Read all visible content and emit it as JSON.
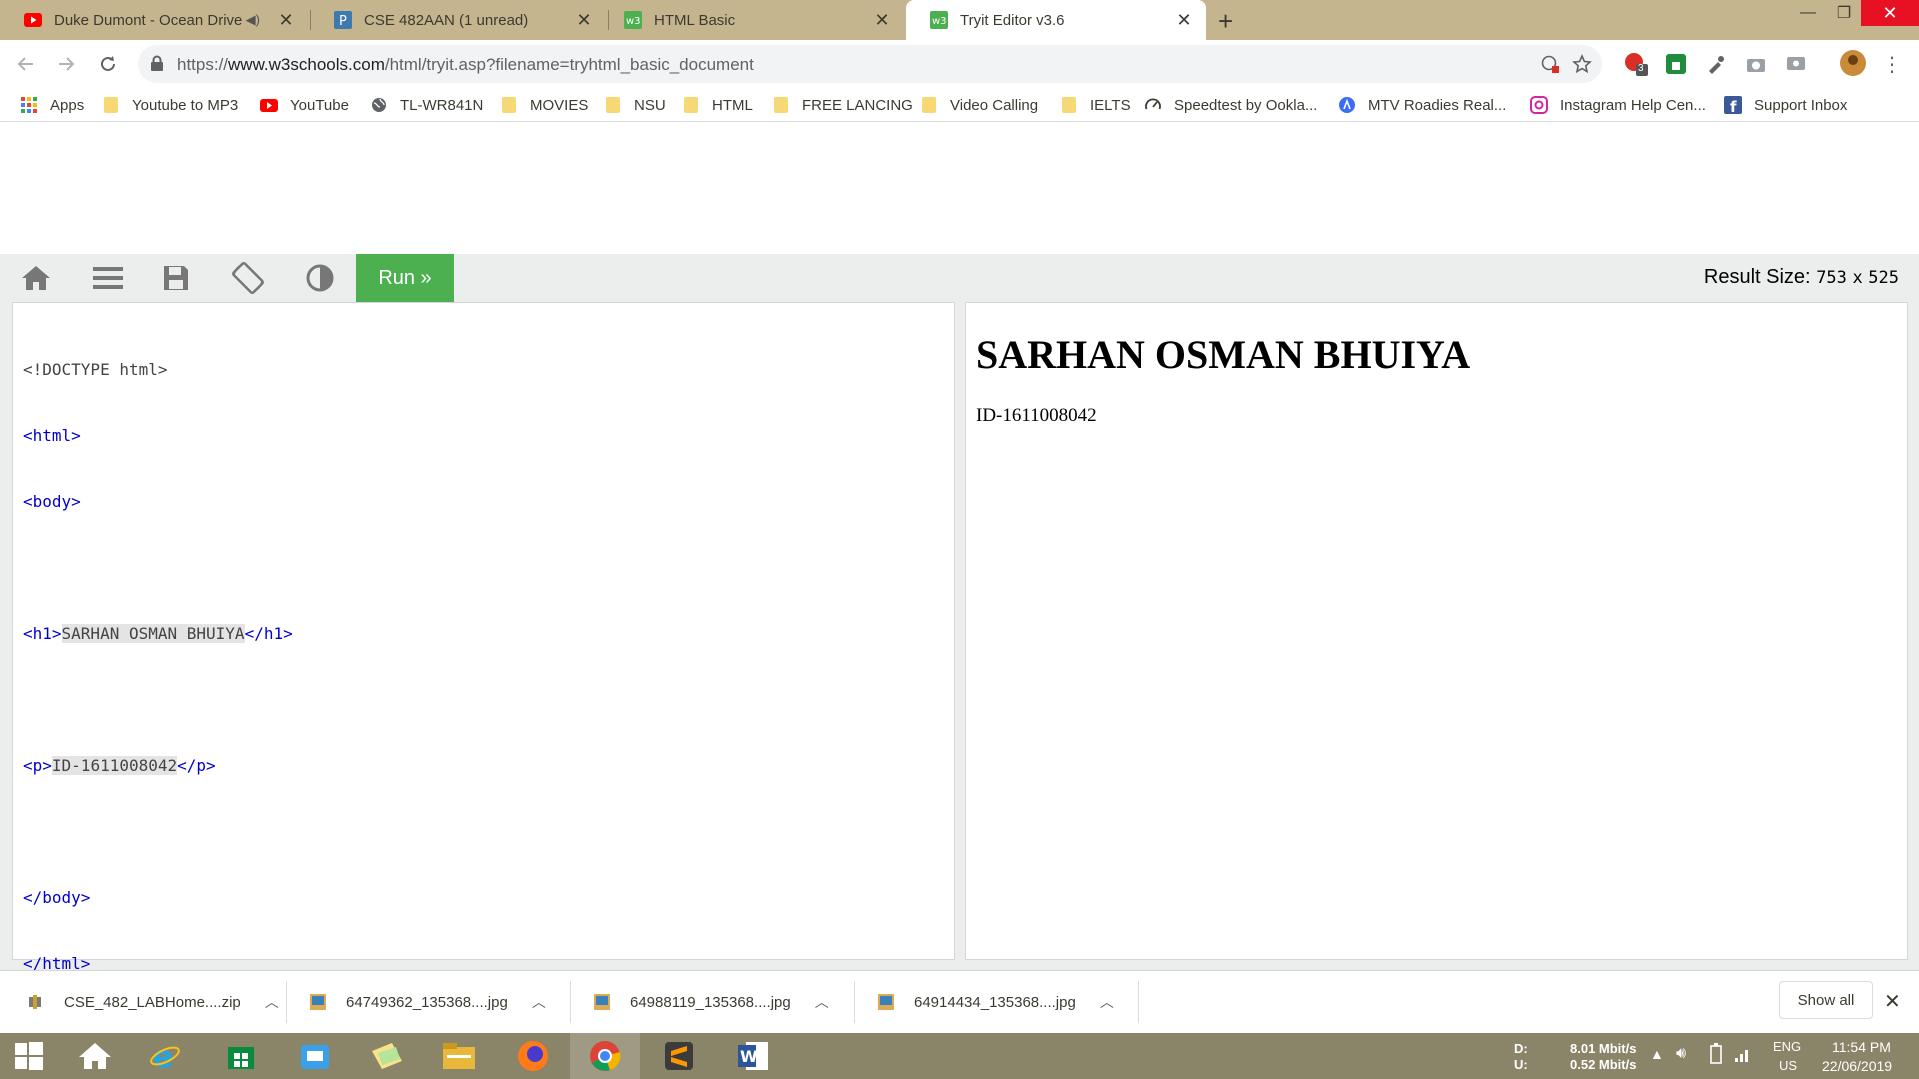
{
  "browser": {
    "tabs": [
      {
        "title": "Duke Dumont - Ocean Drive",
        "favicon": "youtube-icon",
        "muted_indicator": "speaker-icon"
      },
      {
        "title": "CSE 482AAN (1 unread)",
        "favicon": "piazza-icon"
      },
      {
        "title": "HTML Basic",
        "favicon": "w3schools-icon"
      },
      {
        "title": "Tryit Editor v3.6",
        "favicon": "w3schools-icon",
        "active": true
      }
    ],
    "url_prefix": "https://",
    "url_host": "www.w3schools.com",
    "url_path": "/html/tryit.asp?filename=tryhtml_basic_document",
    "extension_badge": "3",
    "bookmarks": [
      {
        "label": "Apps",
        "icon": "apps-grid-icon"
      },
      {
        "label": "Youtube to MP3",
        "icon": "folder-icon"
      },
      {
        "label": "YouTube",
        "icon": "youtube-icon"
      },
      {
        "label": "TL-WR841N",
        "icon": "globe-icon"
      },
      {
        "label": "MOVIES",
        "icon": "folder-icon"
      },
      {
        "label": "NSU",
        "icon": "folder-icon"
      },
      {
        "label": "HTML",
        "icon": "folder-icon"
      },
      {
        "label": "FREE LANCING",
        "icon": "folder-icon"
      },
      {
        "label": "Video Calling",
        "icon": "folder-icon"
      },
      {
        "label": "IELTS",
        "icon": "folder-icon"
      },
      {
        "label": "Speedtest by Ookla...",
        "icon": "speedometer-icon"
      },
      {
        "label": "MTV Roadies Real...",
        "icon": "arrow-circle-icon"
      },
      {
        "label": "Instagram Help Cen...",
        "icon": "instagram-icon"
      },
      {
        "label": "Support Inbox",
        "icon": "facebook-icon"
      }
    ]
  },
  "editor": {
    "run_label": "Run »",
    "result_size_label": "Result Size:",
    "result_width": "753",
    "result_times": "x",
    "result_height": "525",
    "code_lines": [
      "<!DOCTYPE html>",
      "<html>",
      "<body>",
      "",
      "<h1>SARHAN OSMAN BHUIYA</h1>",
      "",
      "<p>ID-1611008042</p>",
      "",
      "</body>",
      "</html>"
    ],
    "code_tokens": {
      "doctype": "<!DOCTYPE html>",
      "html_open": "<html>",
      "body_open": "<body>",
      "h1_open": "<h1>",
      "h1_text": "SARHAN OSMAN BHUIYA",
      "h1_close": "</h1>",
      "p_open": "<p>",
      "p_text": "ID-1611008042",
      "p_close": "</p>",
      "body_close": "</body>",
      "html_close": "</html>"
    },
    "result_heading": "SARHAN OSMAN BHUIYA",
    "result_paragraph": "ID-1611008042"
  },
  "downloads": {
    "items": [
      {
        "name": "CSE_482_LABHome....zip",
        "icon": "zip-icon"
      },
      {
        "name": "64749362_135368....jpg",
        "icon": "image-icon"
      },
      {
        "name": "64988119_135368....jpg",
        "icon": "image-icon"
      },
      {
        "name": "64914434_135368....jpg",
        "icon": "image-icon"
      }
    ],
    "show_all_label": "Show all"
  },
  "taskbar": {
    "apps": [
      "windows-start-icon",
      "home-icon",
      "internet-explorer-icon",
      "store-icon",
      "mail-icon",
      "sticky-notes-icon",
      "file-explorer-icon",
      "firefox-icon",
      "chrome-icon",
      "sublime-text-icon",
      "word-icon"
    ],
    "net_d_label": "D:",
    "net_u_label": "U:",
    "net_down": "8.01 Mbit/s",
    "net_up": "0.52 Mbit/s",
    "lang": "ENG",
    "region": "US",
    "time": "11:54 PM",
    "date": "22/06/2019"
  },
  "colors": {
    "run_green": "#4caf50",
    "tabbar": "#c4b58e",
    "close_red": "#e81123",
    "code_tag": "#a52a2a",
    "code_blue": "#0000cd"
  }
}
